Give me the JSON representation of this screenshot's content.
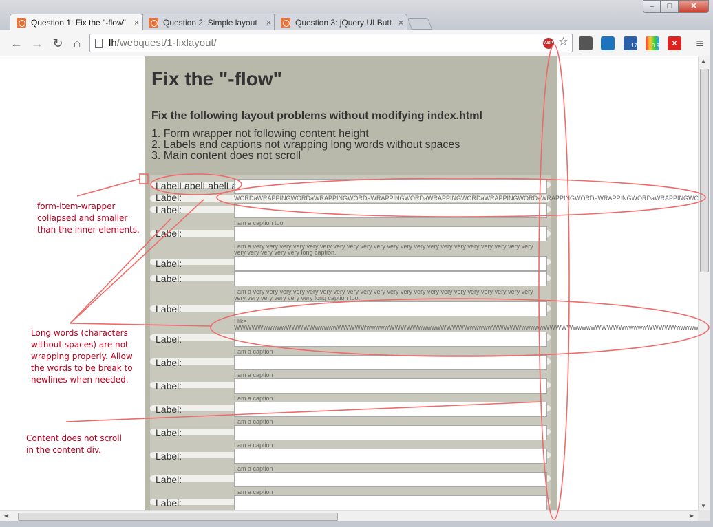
{
  "browser": {
    "tabs": [
      {
        "label": "Question 1: Fix the \"-flow\"",
        "active": true
      },
      {
        "label": "Question 2: Simple layout",
        "active": false
      },
      {
        "label": "Question 3: jQuery UI Butt",
        "active": false
      }
    ],
    "tab_close": "×",
    "window_buttons": {
      "minimize": "–",
      "maximize": "□",
      "close": "✕"
    },
    "url_host": "lh",
    "url_path": "/webquest/1-fixlayout/",
    "adblock_label": "ABP",
    "extension_badge_1": "17",
    "extension_badge_2": "0.9",
    "icons": [
      "back-icon",
      "forward-icon",
      "reload-icon",
      "home-icon",
      "page-icon",
      "adblock-icon",
      "star-icon",
      "menu-icon"
    ]
  },
  "page": {
    "title": "Fix the \"-flow\"",
    "subtitle": "Fix the following layout problems without modifying index.html",
    "problems": [
      "1.  Form wrapper not following content height",
      "2.  Labels and captions not wrapping long words without spaces",
      "3.  Main content does not scroll"
    ],
    "colors": {
      "main_bg": "#b9b9ab",
      "annotation": "#e83030"
    }
  },
  "form": {
    "label_long": "LabelLabelLabelLabelLabel",
    "label": "Label:",
    "caption_long_word": "WORDaWRAPPINGWORDaWRAPPINGWORDaWRAPPINGWORDaWRAPPINGWORDaWRAPPINGWORDaWRAPPINGWORDaWRAPPINGWORDaWRAPPINGWORDaWRAPPINGWORDaWRAPPINGWORDaWRAPPINGWORD",
    "caption_too": "I am a caption too",
    "caption_very_long_1": "I am a very very very very very very very very very very very very very very very very very very very very very very very very very very long caption.",
    "caption_very_long_2": "I am a very very very very very very very very very very very very very very very very very very very very very very very very very very very long caption too.",
    "caption_like_1": "I like",
    "caption_like_2": "WWWWWwwwwwWWWWWwwwwwWWWWWwwwwwWWWWWwwwwwWWWWWwwwwwWWWWWwwwwwWWWWWwwwwwWWWWWwwwwwWWWWWwwwwwWWWWWwwwwwWWWWWwwwwwWWWWWwwwww",
    "caption": "I am a caption"
  },
  "annotations": {
    "wrapper_note": [
      "form-item-wrapper",
      "collapsed and smaller",
      "than the inner elements."
    ],
    "words_note": [
      "Long words (characters",
      "without spaces) are not",
      "wrapping properly. Allow",
      "the words to be break to",
      "newlines when needed."
    ],
    "scroll_note": [
      "Content does not scroll",
      "in the content div."
    ]
  }
}
